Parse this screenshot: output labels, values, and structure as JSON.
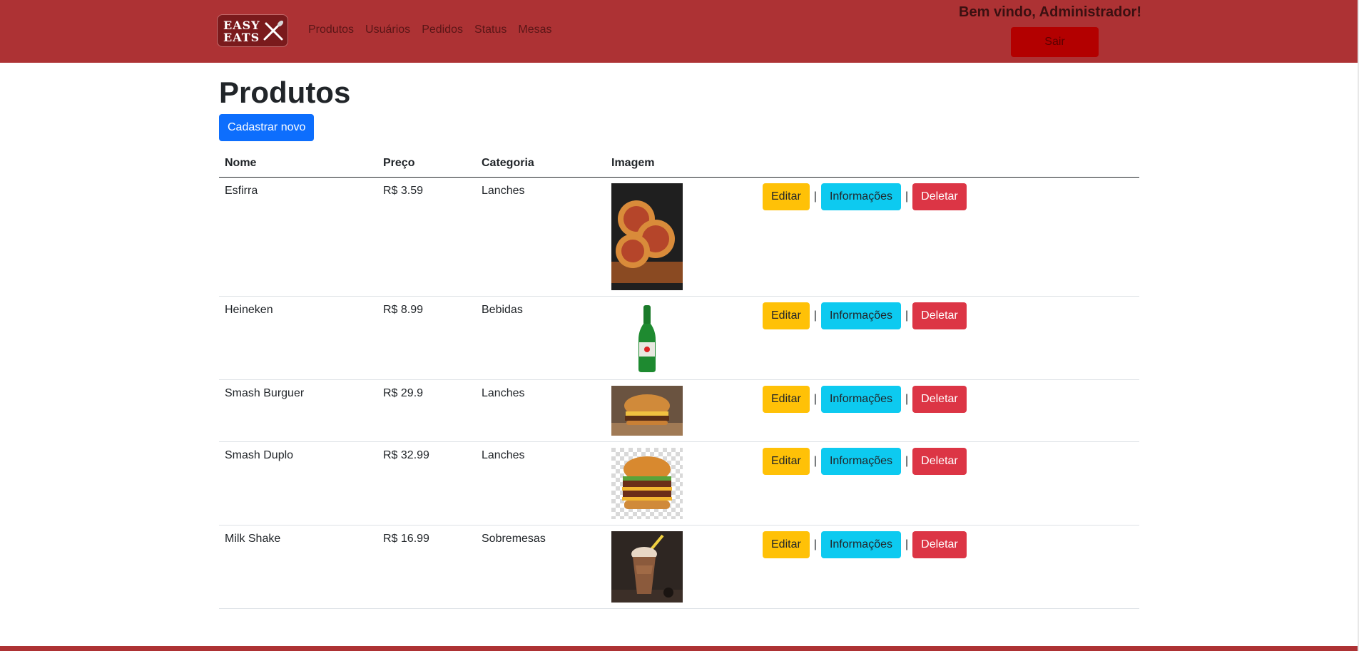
{
  "navbar": {
    "logo_line1": "EASY",
    "logo_line2": "EATS",
    "links": [
      "Produtos",
      "Usuários",
      "Pedidos",
      "Status",
      "Mesas"
    ],
    "welcome": "Bem vindo, Administrador!",
    "logout_label": "Sair"
  },
  "page": {
    "title": "Produtos",
    "new_button": "Cadastrar novo"
  },
  "table": {
    "headers": [
      "Nome",
      "Preço",
      "Categoria",
      "Imagem"
    ],
    "rows": [
      {
        "nome": "Esfirra",
        "preco": "R$ 3.59",
        "categoria": "Lanches",
        "image_icon": "esfirra-image"
      },
      {
        "nome": "Heineken",
        "preco": "R$ 8.99",
        "categoria": "Bebidas",
        "image_icon": "beer-bottle-image"
      },
      {
        "nome": "Smash Burguer",
        "preco": "R$ 29.9",
        "categoria": "Lanches",
        "image_icon": "burger-image"
      },
      {
        "nome": "Smash Duplo",
        "preco": "R$ 32.99",
        "categoria": "Lanches",
        "image_icon": "double-burger-image"
      },
      {
        "nome": "Milk Shake",
        "preco": "R$ 16.99",
        "categoria": "Sobremesas",
        "image_icon": "milkshake-image"
      }
    ],
    "actions": {
      "edit": "Editar",
      "info": "Informações",
      "delete": "Deletar",
      "separator": "|"
    }
  },
  "colors": {
    "navbar": "#ad3234",
    "logout": "#b30000",
    "primary": "#0d6efd",
    "warning": "#ffc107",
    "info": "#0dcaf0",
    "danger": "#dc3545"
  }
}
